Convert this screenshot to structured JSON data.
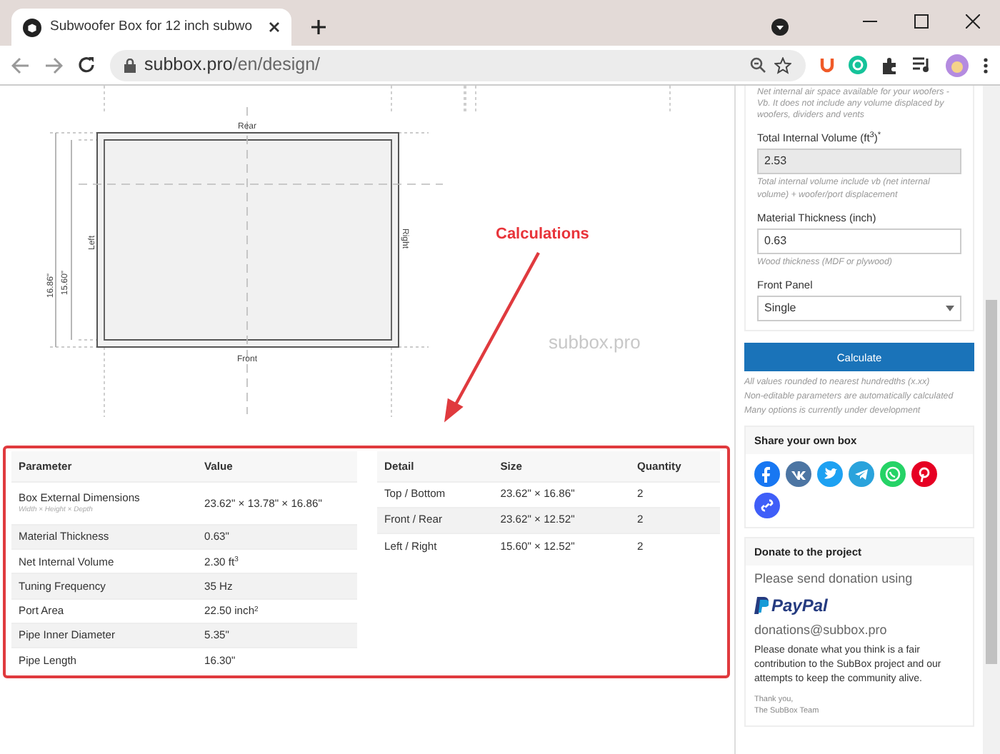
{
  "browser": {
    "tab_title": "Subwoofer Box for 12 inch subwo",
    "url_host": "subbox.pro",
    "url_path": "/en/design/"
  },
  "diagram": {
    "rear": "Rear",
    "front": "Front",
    "left": "Left",
    "right": "Right",
    "outer_height": "16.86\"",
    "inner_height": "15.60\"",
    "site_mark": "subbox.pro"
  },
  "annotation": {
    "label": "Calculations"
  },
  "parameters_table": {
    "columns": [
      "Parameter",
      "Value"
    ],
    "rows": [
      {
        "parameter": "Box External Dimensions",
        "note": "Width × Height × Depth",
        "value": "23.62\" × 13.78\" × 16.86\""
      },
      {
        "parameter": "Material Thickness",
        "value": "0.63\""
      },
      {
        "parameter": "Net Internal Volume",
        "value": "2.30 ft$^{3}$"
      },
      {
        "parameter": "Tuning Frequency",
        "value": "35 Hz"
      },
      {
        "parameter": "Port Area",
        "value": "22.50 inch$^{2}$"
      },
      {
        "parameter": "Pipe Inner Diameter",
        "value": "5.35\""
      },
      {
        "parameter": "Pipe Length",
        "value": "16.30\""
      }
    ]
  },
  "parts_table": {
    "columns": [
      "Detail",
      "Size",
      "Quantity"
    ],
    "rows": [
      {
        "detail": "Top / Bottom",
        "size": "23.62\" × 16.86\"",
        "quantity": "2"
      },
      {
        "detail": "Front / Rear",
        "size": "23.62\" × 12.52\"",
        "quantity": "2"
      },
      {
        "detail": "Left / Right",
        "size": "15.60\" × 12.52\"",
        "quantity": "2"
      }
    ]
  },
  "sidebar": {
    "top_help": "Net internal air space available for your woofers - Vb. It does not include any volume displaced by woofers, dividers and vents",
    "fields": [
      {
        "kind": "input",
        "label": "Total Internal Volume (ft$^{3}$)$^{*}$",
        "value": "2.53",
        "disabled": true,
        "help": "Total internal volume include vb (net internal volume) + woofer/port displacement"
      },
      {
        "kind": "input",
        "label": "Material Thickness (inch)",
        "value": "0.63",
        "disabled": false,
        "help": "Wood thickness (MDF or plywood)"
      },
      {
        "kind": "select",
        "label": "Front Panel",
        "value": "Single",
        "disabled": false
      }
    ],
    "button": "Calculate",
    "notes": [
      "All values rounded to nearest hundredths (x.xx)",
      "Non-editable parameters are automatically calculated",
      "Many options is currently under development"
    ],
    "share": {
      "title": "Share your own box",
      "buttons": [
        {
          "kind": "f",
          "color": "#1877f2"
        },
        {
          "kind": "vk",
          "color": "#4c75a3"
        },
        {
          "kind": "bird",
          "color": "#1da1f2"
        },
        {
          "kind": "plane",
          "color": "#2aa3dc"
        },
        {
          "kind": "phone",
          "color": "#25d366"
        },
        {
          "kind": "p",
          "color": "#e60023"
        },
        {
          "kind": "link",
          "color": "#3f5ef8"
        }
      ]
    },
    "donate": {
      "title": "Donate to the project",
      "intro": "Please send donation using",
      "logo": "PayPal",
      "email": "donations@subbox.pro",
      "text": "Please donate what you think is a fair contribution to the SubBox project and our attempts to keep the community alive.",
      "thanks": "Thank you,",
      "team": "The SubBox Team"
    }
  }
}
